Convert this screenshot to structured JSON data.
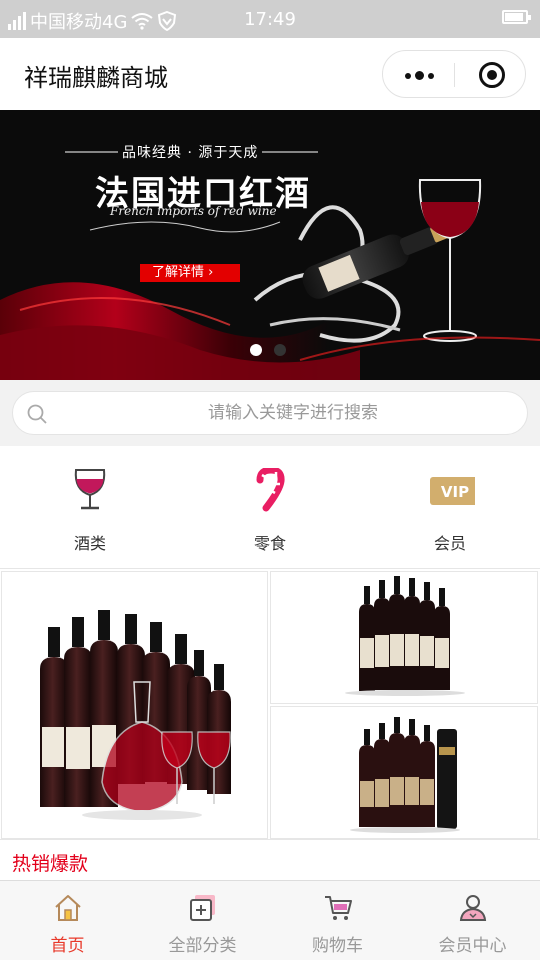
{
  "status_bar": {
    "carrier": "中国移动4G",
    "time": "17:49"
  },
  "nav": {
    "title": "祥瑞麒麟商城"
  },
  "banner": {
    "tagline": "品味经典 · 源于天成",
    "headline": "法国进口红酒",
    "subline": "French imports of red wine",
    "cta": "了解详情",
    "slide_count": 2,
    "active_slide": 1
  },
  "search": {
    "placeholder": "请输入关键字进行搜索"
  },
  "categories": [
    {
      "label": "酒类",
      "icon": "wine-glass-icon"
    },
    {
      "label": "零食",
      "icon": "candy-cane-icon"
    },
    {
      "label": "会员",
      "icon": "vip-badge-icon"
    }
  ],
  "hot_section": {
    "title": "热销爆款"
  },
  "tabbar": [
    {
      "label": "首页",
      "icon": "home-icon",
      "active": true
    },
    {
      "label": "全部分类",
      "icon": "category-icon",
      "active": false
    },
    {
      "label": "购物车",
      "icon": "cart-icon",
      "active": false
    },
    {
      "label": "会员中心",
      "icon": "user-icon",
      "active": false
    }
  ],
  "colors": {
    "accent": "#e8392a",
    "hot_title": "#e3001b",
    "banner_cta": "#e30000",
    "wine": "#c2185b"
  }
}
